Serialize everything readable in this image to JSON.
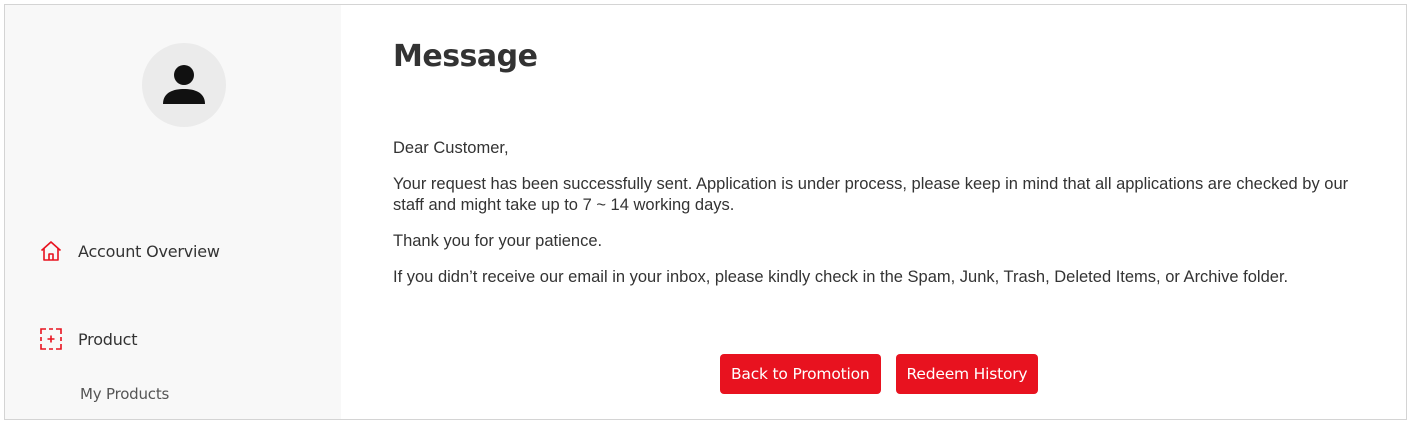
{
  "sidebar": {
    "avatar_icon": "user-icon",
    "items": [
      {
        "label": "Account Overview",
        "icon": "home-icon"
      },
      {
        "label": "Product",
        "icon": "product-icon"
      }
    ],
    "subitems": [
      {
        "label": "My Products"
      }
    ]
  },
  "main": {
    "title": "Message",
    "paragraphs": [
      "Dear Customer,",
      "Your request has been successfully sent. Application is under process, please keep in mind that all applications are checked by our staff and might take up to 7 ~ 14 working days.",
      "Thank you for your patience.",
      "If you didn’t receive our email in your inbox, please kindly check in the Spam, Junk, Trash, Deleted Items, or Archive folder."
    ],
    "buttons": {
      "back_label": "Back to Promotion",
      "history_label": "Redeem History"
    }
  },
  "colors": {
    "accent": "#e8121f",
    "sidebar_bg": "#f8f8f8",
    "avatar_bg": "#ebebeb",
    "text": "#333333"
  }
}
